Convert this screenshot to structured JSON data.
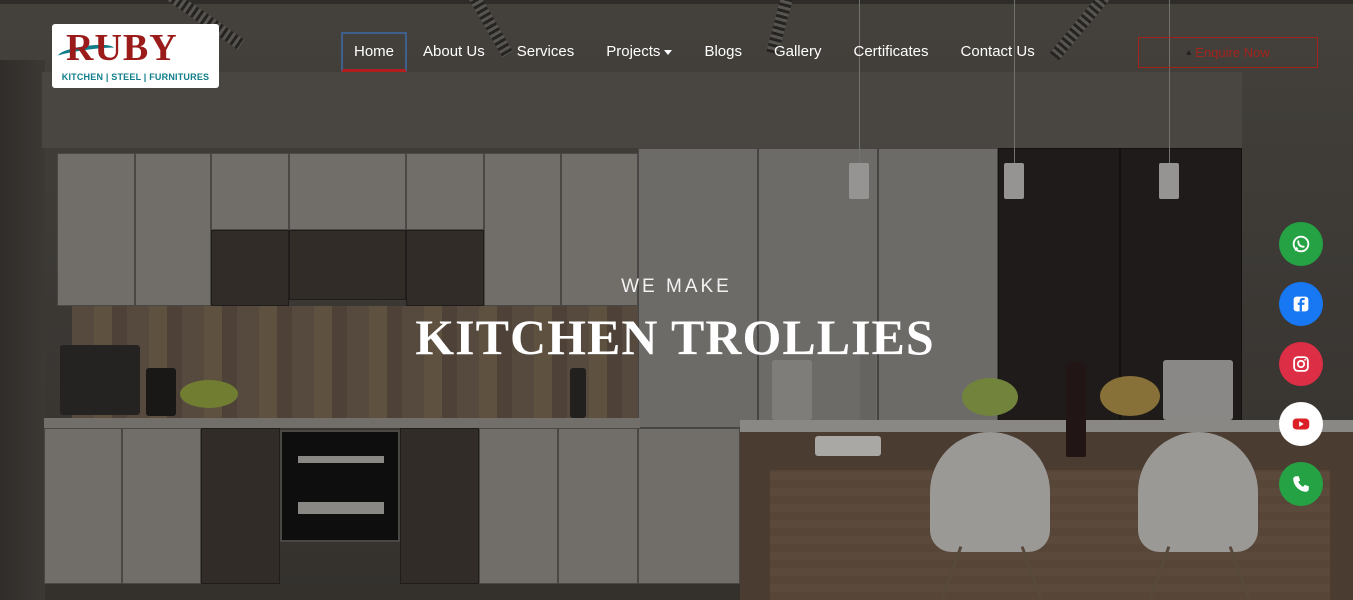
{
  "logo": {
    "wordmark": "RUBY",
    "tagline": "KITCHEN | STEEL | FURNITURES"
  },
  "nav": {
    "items": [
      {
        "label": "Home",
        "active": true
      },
      {
        "label": "About Us"
      },
      {
        "label": "Services"
      },
      {
        "label": "Projects",
        "dropdown": true
      },
      {
        "label": "Blogs"
      },
      {
        "label": "Gallery"
      },
      {
        "label": "Certificates"
      },
      {
        "label": "Contact Us"
      }
    ]
  },
  "cta": {
    "label": "Enquire Now",
    "icon": "arrow-icon",
    "color": "#a3241d"
  },
  "hero": {
    "eyebrow": "WE MAKE",
    "headline": "KITCHEN TROLLIES"
  },
  "social": [
    {
      "name": "whatsapp-icon",
      "color": "#25a244"
    },
    {
      "name": "facebook-icon",
      "color": "#1877f2"
    },
    {
      "name": "instagram-icon",
      "color": "#dc2f45"
    },
    {
      "name": "youtube-icon",
      "color": "#ffffff"
    },
    {
      "name": "phone-icon",
      "color": "#25a244"
    }
  ],
  "colors": {
    "accent_red": "#b21e1e",
    "active_border": "#3f5f8f",
    "brand_teal": "#0f7d8a"
  }
}
